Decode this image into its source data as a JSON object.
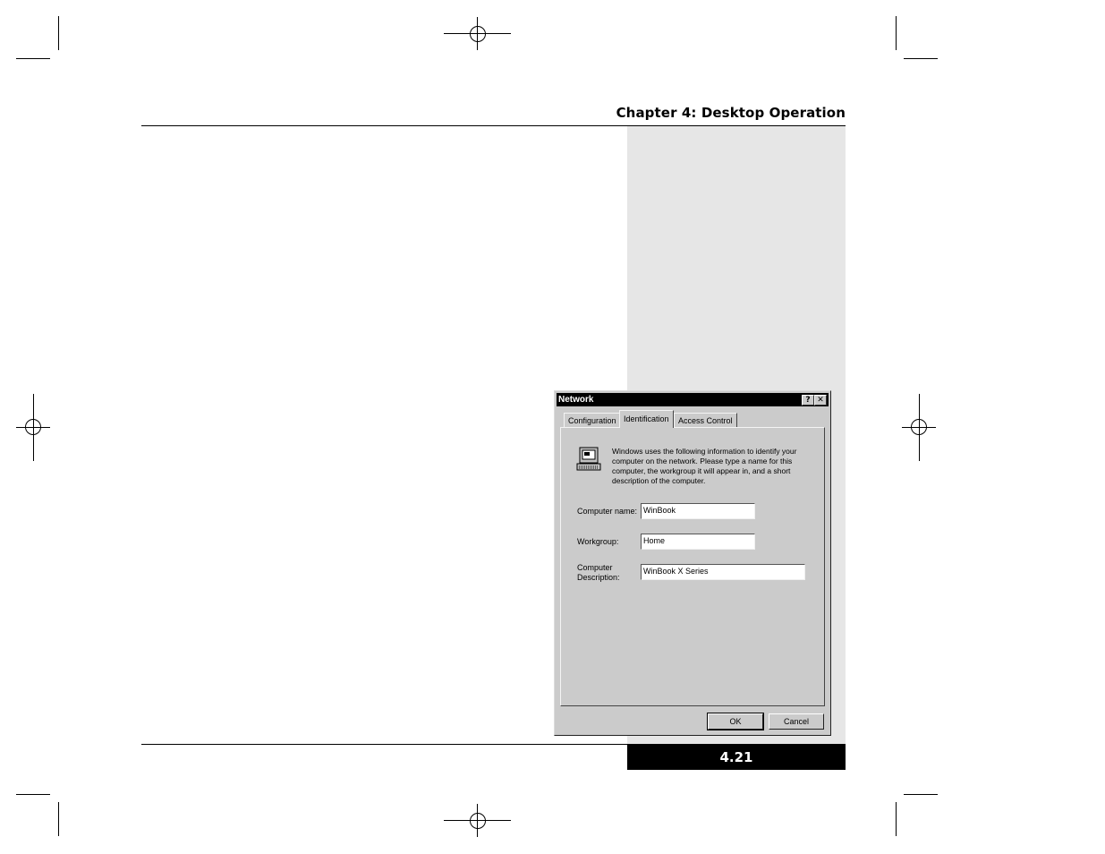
{
  "page": {
    "chapter_title": "Chapter 4: Desktop Operation",
    "page_number": "4.21"
  },
  "dialog": {
    "title": "Network",
    "help_button": "?",
    "close_button": "✕",
    "tabs": [
      {
        "label": "Configuration",
        "active": false
      },
      {
        "label": "Identification",
        "active": true
      },
      {
        "label": "Access Control",
        "active": false
      }
    ],
    "intro_text": "Windows uses the following information to identify your computer on the network.  Please type a name for this computer, the workgroup it will appear in, and a short description of the computer.",
    "fields": {
      "computer_name": {
        "label": "Computer name:",
        "value": "WinBook"
      },
      "workgroup": {
        "label": "Workgroup:",
        "value": "Home"
      },
      "description": {
        "label_line1": "Computer",
        "label_line2": "Description:",
        "value": "WinBook X Series"
      }
    },
    "buttons": {
      "ok": "OK",
      "cancel": "Cancel"
    },
    "icon": "network-computer-icon"
  },
  "colors": {
    "dialog_face": "#cbcbcb",
    "titlebar": "#000000",
    "side_panel": "#e6e6e6",
    "page_number_bg": "#000000"
  }
}
